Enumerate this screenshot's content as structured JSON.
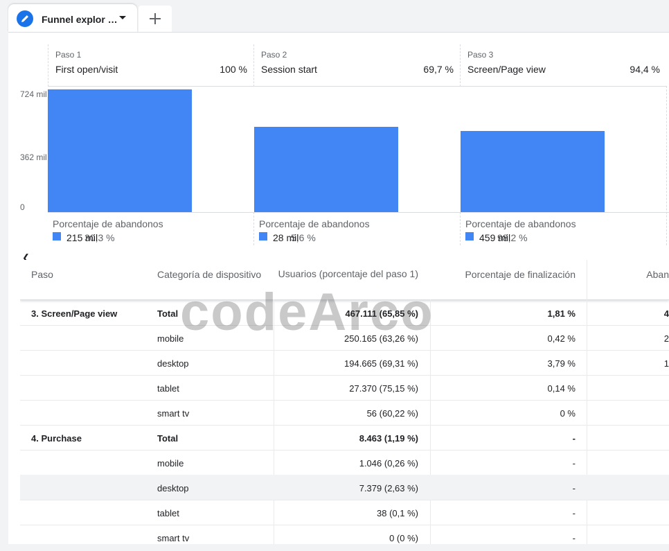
{
  "tab": {
    "label": "Funnel explor …"
  },
  "chart": {
    "y_ticks": [
      "724 mil",
      "362 mil",
      "0"
    ],
    "abandon_title": "Porcentaje de abandonos",
    "steps": [
      {
        "num": "Paso 1",
        "name": "First open/visit",
        "pct": "100 %",
        "abandon_value": "215 mil",
        "abandon_pct": "30,3 %"
      },
      {
        "num": "Paso 2",
        "name": "Session start",
        "pct": "69,7 %",
        "abandon_value": "28 mil",
        "abandon_pct": "5,6 %"
      },
      {
        "num": "Paso 3",
        "name": "Screen/Page view",
        "pct": "94,4 %",
        "abandon_value": "459 mil",
        "abandon_pct": "98,2 %"
      }
    ]
  },
  "chart_data": {
    "type": "bar",
    "categories": [
      "First open/visit",
      "Session start",
      "Screen/Page view"
    ],
    "values": [
      724000,
      505000,
      477000
    ],
    "ylim": [
      0,
      724000
    ]
  },
  "table": {
    "headers": [
      "Paso",
      "Categoría de dispositivo",
      "Usuarios (porcentaje del paso 1)",
      "Porcentaje de finalización",
      "Aban"
    ],
    "rows": [
      {
        "step": "3. Screen/Page view",
        "device": "Total",
        "users": "467.111 (65,85 %)",
        "completion": "1,81 %",
        "aband": "4"
      },
      {
        "step": "",
        "device": "mobile",
        "users": "250.165 (63,26 %)",
        "completion": "0,42 %",
        "aband": "2"
      },
      {
        "step": "",
        "device": "desktop",
        "users": "194.665 (69,31 %)",
        "completion": "3,79 %",
        "aband": "1"
      },
      {
        "step": "",
        "device": "tablet",
        "users": "27.370 (75,15 %)",
        "completion": "0,14 %",
        "aband": ""
      },
      {
        "step": "",
        "device": "smart tv",
        "users": "56 (60,22 %)",
        "completion": "0 %",
        "aband": ""
      },
      {
        "step": "4. Purchase",
        "device": "Total",
        "users": "8.463 (1,19 %)",
        "completion": "-",
        "aband": ""
      },
      {
        "step": "",
        "device": "mobile",
        "users": "1.046 (0,26 %)",
        "completion": "-",
        "aband": ""
      },
      {
        "step": "",
        "device": "desktop",
        "users": "7.379 (2,63 %)",
        "completion": "-",
        "aband": ""
      },
      {
        "step": "",
        "device": "tablet",
        "users": "38 (0,1 %)",
        "completion": "-",
        "aband": ""
      },
      {
        "step": "",
        "device": "smart tv",
        "users": "0 (0 %)",
        "completion": "-",
        "aband": ""
      }
    ]
  },
  "watermark": "codeArco",
  "colors": {
    "accent": "#1a73e8",
    "bar": "#4285f4"
  }
}
